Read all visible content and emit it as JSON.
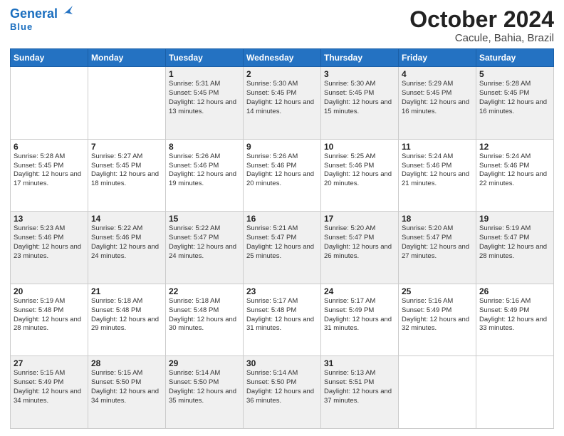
{
  "header": {
    "logo_general": "General",
    "logo_blue": "Blue",
    "month_title": "October 2024",
    "location": "Cacule, Bahia, Brazil"
  },
  "weekdays": [
    "Sunday",
    "Monday",
    "Tuesday",
    "Wednesday",
    "Thursday",
    "Friday",
    "Saturday"
  ],
  "weeks": [
    [
      {
        "day": null
      },
      {
        "day": null
      },
      {
        "day": "1",
        "sunrise": "Sunrise: 5:31 AM",
        "sunset": "Sunset: 5:45 PM",
        "daylight": "Daylight: 12 hours and 13 minutes."
      },
      {
        "day": "2",
        "sunrise": "Sunrise: 5:30 AM",
        "sunset": "Sunset: 5:45 PM",
        "daylight": "Daylight: 12 hours and 14 minutes."
      },
      {
        "day": "3",
        "sunrise": "Sunrise: 5:30 AM",
        "sunset": "Sunset: 5:45 PM",
        "daylight": "Daylight: 12 hours and 15 minutes."
      },
      {
        "day": "4",
        "sunrise": "Sunrise: 5:29 AM",
        "sunset": "Sunset: 5:45 PM",
        "daylight": "Daylight: 12 hours and 16 minutes."
      },
      {
        "day": "5",
        "sunrise": "Sunrise: 5:28 AM",
        "sunset": "Sunset: 5:45 PM",
        "daylight": "Daylight: 12 hours and 16 minutes."
      }
    ],
    [
      {
        "day": "6",
        "sunrise": "Sunrise: 5:28 AM",
        "sunset": "Sunset: 5:45 PM",
        "daylight": "Daylight: 12 hours and 17 minutes."
      },
      {
        "day": "7",
        "sunrise": "Sunrise: 5:27 AM",
        "sunset": "Sunset: 5:45 PM",
        "daylight": "Daylight: 12 hours and 18 minutes."
      },
      {
        "day": "8",
        "sunrise": "Sunrise: 5:26 AM",
        "sunset": "Sunset: 5:46 PM",
        "daylight": "Daylight: 12 hours and 19 minutes."
      },
      {
        "day": "9",
        "sunrise": "Sunrise: 5:26 AM",
        "sunset": "Sunset: 5:46 PM",
        "daylight": "Daylight: 12 hours and 20 minutes."
      },
      {
        "day": "10",
        "sunrise": "Sunrise: 5:25 AM",
        "sunset": "Sunset: 5:46 PM",
        "daylight": "Daylight: 12 hours and 20 minutes."
      },
      {
        "day": "11",
        "sunrise": "Sunrise: 5:24 AM",
        "sunset": "Sunset: 5:46 PM",
        "daylight": "Daylight: 12 hours and 21 minutes."
      },
      {
        "day": "12",
        "sunrise": "Sunrise: 5:24 AM",
        "sunset": "Sunset: 5:46 PM",
        "daylight": "Daylight: 12 hours and 22 minutes."
      }
    ],
    [
      {
        "day": "13",
        "sunrise": "Sunrise: 5:23 AM",
        "sunset": "Sunset: 5:46 PM",
        "daylight": "Daylight: 12 hours and 23 minutes."
      },
      {
        "day": "14",
        "sunrise": "Sunrise: 5:22 AM",
        "sunset": "Sunset: 5:46 PM",
        "daylight": "Daylight: 12 hours and 24 minutes."
      },
      {
        "day": "15",
        "sunrise": "Sunrise: 5:22 AM",
        "sunset": "Sunset: 5:47 PM",
        "daylight": "Daylight: 12 hours and 24 minutes."
      },
      {
        "day": "16",
        "sunrise": "Sunrise: 5:21 AM",
        "sunset": "Sunset: 5:47 PM",
        "daylight": "Daylight: 12 hours and 25 minutes."
      },
      {
        "day": "17",
        "sunrise": "Sunrise: 5:20 AM",
        "sunset": "Sunset: 5:47 PM",
        "daylight": "Daylight: 12 hours and 26 minutes."
      },
      {
        "day": "18",
        "sunrise": "Sunrise: 5:20 AM",
        "sunset": "Sunset: 5:47 PM",
        "daylight": "Daylight: 12 hours and 27 minutes."
      },
      {
        "day": "19",
        "sunrise": "Sunrise: 5:19 AM",
        "sunset": "Sunset: 5:47 PM",
        "daylight": "Daylight: 12 hours and 28 minutes."
      }
    ],
    [
      {
        "day": "20",
        "sunrise": "Sunrise: 5:19 AM",
        "sunset": "Sunset: 5:48 PM",
        "daylight": "Daylight: 12 hours and 28 minutes."
      },
      {
        "day": "21",
        "sunrise": "Sunrise: 5:18 AM",
        "sunset": "Sunset: 5:48 PM",
        "daylight": "Daylight: 12 hours and 29 minutes."
      },
      {
        "day": "22",
        "sunrise": "Sunrise: 5:18 AM",
        "sunset": "Sunset: 5:48 PM",
        "daylight": "Daylight: 12 hours and 30 minutes."
      },
      {
        "day": "23",
        "sunrise": "Sunrise: 5:17 AM",
        "sunset": "Sunset: 5:48 PM",
        "daylight": "Daylight: 12 hours and 31 minutes."
      },
      {
        "day": "24",
        "sunrise": "Sunrise: 5:17 AM",
        "sunset": "Sunset: 5:49 PM",
        "daylight": "Daylight: 12 hours and 31 minutes."
      },
      {
        "day": "25",
        "sunrise": "Sunrise: 5:16 AM",
        "sunset": "Sunset: 5:49 PM",
        "daylight": "Daylight: 12 hours and 32 minutes."
      },
      {
        "day": "26",
        "sunrise": "Sunrise: 5:16 AM",
        "sunset": "Sunset: 5:49 PM",
        "daylight": "Daylight: 12 hours and 33 minutes."
      }
    ],
    [
      {
        "day": "27",
        "sunrise": "Sunrise: 5:15 AM",
        "sunset": "Sunset: 5:49 PM",
        "daylight": "Daylight: 12 hours and 34 minutes."
      },
      {
        "day": "28",
        "sunrise": "Sunrise: 5:15 AM",
        "sunset": "Sunset: 5:50 PM",
        "daylight": "Daylight: 12 hours and 34 minutes."
      },
      {
        "day": "29",
        "sunrise": "Sunrise: 5:14 AM",
        "sunset": "Sunset: 5:50 PM",
        "daylight": "Daylight: 12 hours and 35 minutes."
      },
      {
        "day": "30",
        "sunrise": "Sunrise: 5:14 AM",
        "sunset": "Sunset: 5:50 PM",
        "daylight": "Daylight: 12 hours and 36 minutes."
      },
      {
        "day": "31",
        "sunrise": "Sunrise: 5:13 AM",
        "sunset": "Sunset: 5:51 PM",
        "daylight": "Daylight: 12 hours and 37 minutes."
      },
      {
        "day": null
      },
      {
        "day": null
      }
    ]
  ]
}
